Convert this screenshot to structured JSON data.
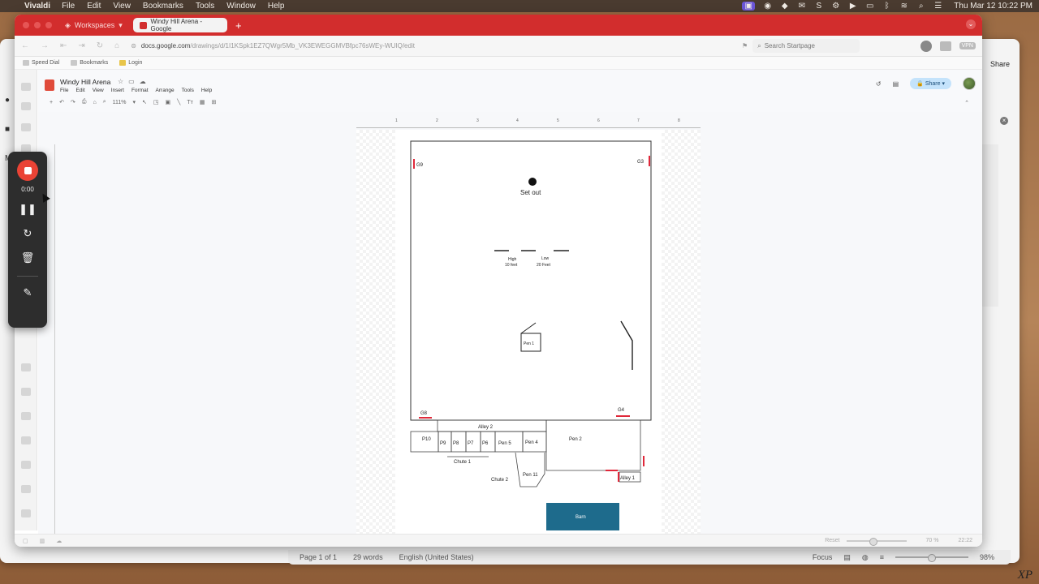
{
  "menubar": {
    "app_name": "Vivaldi",
    "items": [
      "File",
      "Edit",
      "View",
      "Bookmarks",
      "Tools",
      "Window",
      "Help"
    ],
    "clock": "Thu Mar 12  10:22 PM"
  },
  "background_window": {
    "share_label": "Share",
    "status": {
      "page": "Page 1 of 1",
      "words": "29 words",
      "language": "English (United States)",
      "focus": "Focus",
      "zoom": "98%"
    }
  },
  "browser": {
    "workspaces_label": "Workspaces",
    "tab_title": "Windy Hill Arena - Google",
    "url_host": "docs.google.com",
    "url_path": "/drawings/d/1I1KSpk1EZ7QWgr5Mb_VK3EWEGGMVBfpc76sWEy-WUIQ/edit",
    "search_placeholder": "Search Startpage",
    "vpn_label": "VPN",
    "bookmarks": [
      "Speed Dial",
      "Bookmarks",
      "Login"
    ],
    "bottom": {
      "reset": "Reset",
      "zoom": "70 %",
      "time": "22:22"
    }
  },
  "docs": {
    "title": "Windy Hill Arena",
    "menus": [
      "File",
      "Edit",
      "View",
      "Insert",
      "Format",
      "Arrange",
      "Tools",
      "Help"
    ],
    "zoom": "111%",
    "share_label": "Share"
  },
  "ruler_ticks": [
    "1",
    "2",
    "3",
    "4",
    "5",
    "6",
    "7",
    "8"
  ],
  "arena": {
    "gates": [
      "G9",
      "G3",
      "G8",
      "G4"
    ],
    "set_out": "Set out",
    "high_label": "High",
    "high_value": "10 feet",
    "low_label": "Low",
    "low_value": "20 Feet",
    "pen1": "Pen 1",
    "alley2": "Alley 2",
    "pens_row": [
      "P10",
      "P9",
      "P8",
      "P7",
      "P6",
      "Pen 5",
      "Pen 4"
    ],
    "pen2": "Pen 2",
    "chute1": "Chute 1",
    "chute2": "Chute 2",
    "pen11": "Pen 11",
    "alley1": "Alley 1",
    "barn": "Barn"
  },
  "recorder": {
    "time": "0:00"
  },
  "watermark": "XP",
  "colors": {
    "tabbar": "#d22d2d",
    "gate_marker": "#e0283a",
    "barn": "#1e6b8c",
    "record": "#ea4335"
  }
}
